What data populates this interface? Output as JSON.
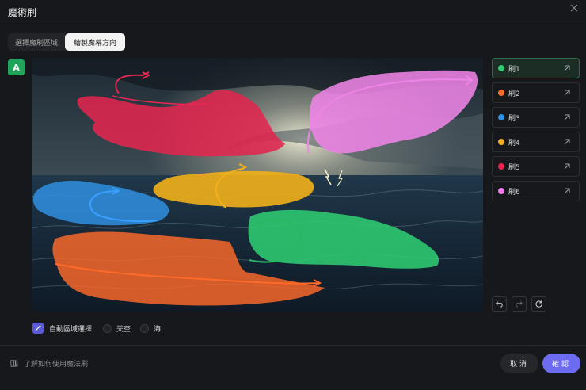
{
  "dialog": {
    "title": "魔術刷",
    "close_icon": "close-icon"
  },
  "tabs": [
    {
      "label": "選擇魔刷區域",
      "active": false
    },
    {
      "label": "繪製魔幕方向",
      "active": true
    }
  ],
  "tool": {
    "icon": "brush-text-icon",
    "glyph": "A",
    "color": "#1fa55a"
  },
  "brushes": [
    {
      "label": "刷1",
      "color": "#2ecc71",
      "active": true
    },
    {
      "label": "刷2",
      "color": "#ff6a2b",
      "active": false
    },
    {
      "label": "刷3",
      "color": "#2f8fe0",
      "active": false
    },
    {
      "label": "刷4",
      "color": "#f2b01a",
      "active": false
    },
    {
      "label": "刷5",
      "color": "#e8234e",
      "active": false
    },
    {
      "label": "刷6",
      "color": "#ee7be8",
      "active": false
    }
  ],
  "controls": {
    "undo_icon": "undo-icon",
    "redo_icon": "redo-icon",
    "reset_icon": "reset-icon"
  },
  "auto_select": {
    "label": "自動區域選擇",
    "options": [
      "天空",
      "海"
    ]
  },
  "footer": {
    "help_text": "了解如何使用魔法刷",
    "cancel_label": "取消",
    "confirm_label": "確認"
  }
}
